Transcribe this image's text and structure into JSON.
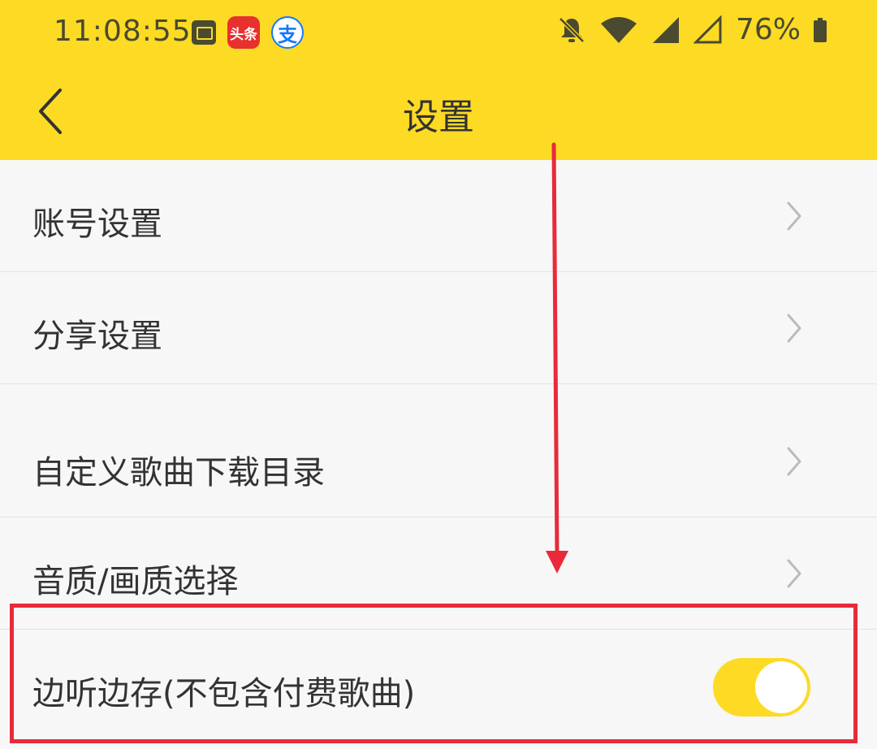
{
  "status_bar": {
    "time": "11:08:55",
    "battery": "76%",
    "toutiao_label": "头条",
    "alipay_label": "支"
  },
  "header": {
    "title": "设置"
  },
  "settings": [
    {
      "label": "账号设置",
      "type": "link"
    },
    {
      "label": "分享设置",
      "type": "link"
    },
    {
      "label": "自定义歌曲下载目录",
      "type": "link"
    },
    {
      "label": "音质/画质选择",
      "type": "link"
    },
    {
      "label": "边听边存(不包含付费歌曲)",
      "type": "toggle",
      "on": true
    }
  ],
  "colors": {
    "accent": "#fdda24",
    "annotation": "#e82a3a",
    "background": "#f7f7f7",
    "text": "#333333",
    "chevron": "#bbbbbb"
  }
}
